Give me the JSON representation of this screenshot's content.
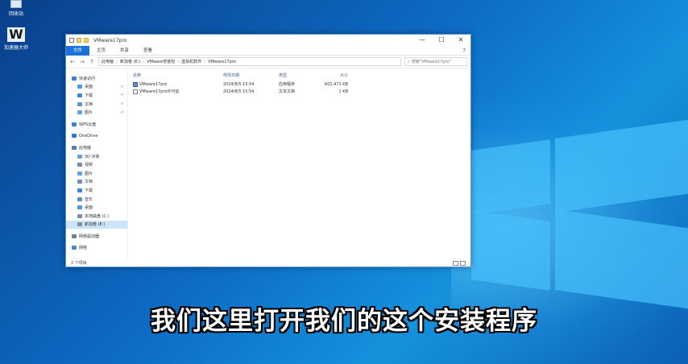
{
  "desktop": {
    "icons": [
      {
        "label": "回收站",
        "icon": "recycle-bin-icon"
      },
      {
        "label": "加速器大师",
        "icon": "wps-w-icon"
      }
    ]
  },
  "window": {
    "title": "VMware17pro",
    "controls": {
      "minimize": "—",
      "maximize": "☐",
      "close": "✕"
    },
    "ribbon": {
      "tabs": [
        "文件",
        "主页",
        "共享",
        "查看"
      ],
      "help": "?"
    },
    "address": {
      "back": "←",
      "forward": "→",
      "up": "↑",
      "path": [
        "此电脑",
        "新加卷 (E:)",
        "VMware安装包",
        "虚拟机软件",
        "VMware17pro"
      ],
      "search_placeholder": "搜索\"VMware17pro\""
    },
    "nav": {
      "items": [
        {
          "label": "快速访问",
          "top": true,
          "color": "#3d7fd6"
        },
        {
          "label": "桌面",
          "pin": "✔",
          "color": "#4a9be6"
        },
        {
          "label": "下载",
          "pin": "✔",
          "color": "#3a86d8"
        },
        {
          "label": "文档",
          "pin": "✔",
          "color": "#6b8fb8"
        },
        {
          "label": "图片",
          "pin": "✔",
          "color": "#5fa4df"
        },
        {
          "label": "WPS云盘",
          "top": true,
          "color": "#3d7fd6"
        },
        {
          "label": "OneDrive",
          "top": true,
          "color": "#2a7ad6"
        },
        {
          "label": "此电脑",
          "top": true,
          "color": "#4f7fb7"
        },
        {
          "label": "3D 对象",
          "color": "#6aa3d8"
        },
        {
          "label": "视频",
          "color": "#6b8fb8"
        },
        {
          "label": "图片",
          "color": "#5fa4df"
        },
        {
          "label": "文档",
          "color": "#6b8fb8"
        },
        {
          "label": "下载",
          "color": "#3a86d8"
        },
        {
          "label": "音乐",
          "color": "#5b8ec4"
        },
        {
          "label": "桌面",
          "color": "#4a9be6"
        },
        {
          "label": "本地磁盘 (C:)",
          "color": "#7a8fa8"
        },
        {
          "label": "新加卷 (E:)",
          "color": "#7a8fa8",
          "selected": true
        },
        {
          "label": "网络驱动器",
          "top": true,
          "color": "#6f7f94"
        },
        {
          "label": "网络",
          "top": true,
          "color": "#4d84c7"
        }
      ]
    },
    "columns": {
      "name": "名称",
      "date": "修改日期",
      "type": "类型",
      "size": "大小"
    },
    "files": [
      {
        "name": "VMware17pro",
        "date": "2024/8/5 15:54",
        "type": "应用程序",
        "size": "602,471 KB",
        "icon": "exe-icon"
      },
      {
        "name": "VMware17pro许可证",
        "date": "2024/8/5 15:54",
        "type": "文本文档",
        "size": "1 KB",
        "icon": "txt-icon"
      }
    ],
    "status": "2 个项目"
  },
  "subtitle": "我们这里打开我们的这个安装程序"
}
